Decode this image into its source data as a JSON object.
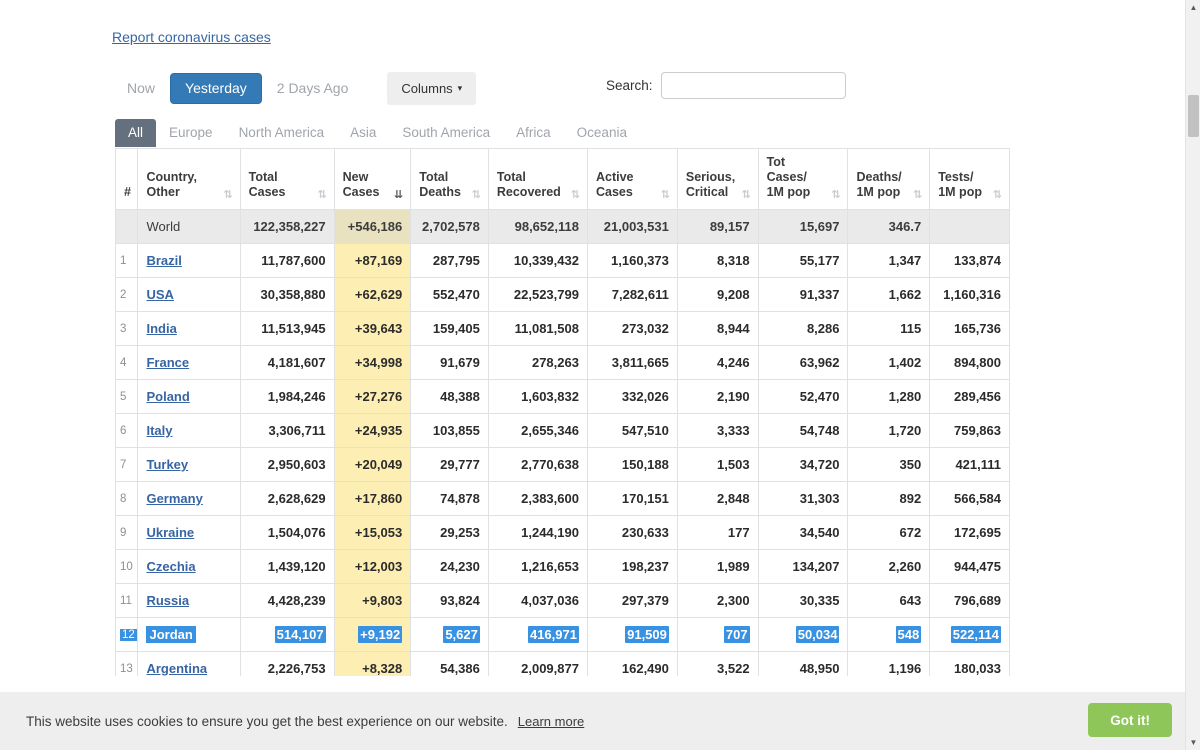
{
  "report_link": "Report coronavirus cases",
  "toolbar": {
    "days": [
      {
        "label": "Now",
        "active": false
      },
      {
        "label": "Yesterday",
        "active": true
      },
      {
        "label": "2 Days Ago",
        "active": false
      }
    ],
    "columns_label": "Columns",
    "columns_caret": "▾",
    "search_label": "Search:",
    "search_value": "",
    "search_placeholder": ""
  },
  "tabs": [
    {
      "label": "All",
      "active": true
    },
    {
      "label": "Europe",
      "active": false
    },
    {
      "label": "North America",
      "active": false
    },
    {
      "label": "Asia",
      "active": false
    },
    {
      "label": "South America",
      "active": false
    },
    {
      "label": "Africa",
      "active": false
    },
    {
      "label": "Oceania",
      "active": false
    }
  ],
  "table": {
    "headers": [
      {
        "key": "num",
        "line1": "#",
        "line2": "",
        "sort": "",
        "sort_active": false
      },
      {
        "key": "ctry",
        "line1": "Country,",
        "line2": "Other",
        "sort": "⇅",
        "sort_active": false
      },
      {
        "key": "tc",
        "line1": "Total",
        "line2": "Cases",
        "sort": "⇅",
        "sort_active": false
      },
      {
        "key": "nc",
        "line1": "New",
        "line2": "Cases",
        "sort": "⇊",
        "sort_active": true
      },
      {
        "key": "td",
        "line1": "Total",
        "line2": "Deaths",
        "sort": "⇅",
        "sort_active": false
      },
      {
        "key": "tr",
        "line1": "Total",
        "line2": "Recovered",
        "sort": "⇅",
        "sort_active": false
      },
      {
        "key": "ac",
        "line1": "Active",
        "line2": "Cases",
        "sort": "⇅",
        "sort_active": false
      },
      {
        "key": "sc",
        "line1": "Serious,",
        "line2": "Critical",
        "sort": "⇅",
        "sort_active": false
      },
      {
        "key": "tcm",
        "line1": "Tot Cases/",
        "line2": "1M pop",
        "sort": "⇅",
        "sort_active": false
      },
      {
        "key": "dm",
        "line1": "Deaths/",
        "line2": "1M pop",
        "sort": "⇅",
        "sort_active": false
      },
      {
        "key": "tm",
        "line1": "Tests/",
        "line2": "1M pop",
        "sort": "⇅",
        "sort_active": false
      }
    ],
    "world_row": {
      "num": "",
      "country": "World",
      "total_cases": "122,358,227",
      "new_cases": "+546,186",
      "total_deaths": "2,702,578",
      "total_recovered": "98,652,118",
      "active_cases": "21,003,531",
      "serious_critical": "89,157",
      "tot_cases_1m": "15,697",
      "deaths_1m": "346.7",
      "tests_1m": ""
    },
    "rows": [
      {
        "num": "1",
        "country": "Brazil",
        "total_cases": "11,787,600",
        "new_cases": "+87,169",
        "total_deaths": "287,795",
        "total_recovered": "10,339,432",
        "active_cases": "1,160,373",
        "serious_critical": "8,318",
        "tot_cases_1m": "55,177",
        "deaths_1m": "1,347",
        "tests_1m": "133,874",
        "selected": false
      },
      {
        "num": "2",
        "country": "USA",
        "total_cases": "30,358,880",
        "new_cases": "+62,629",
        "total_deaths": "552,470",
        "total_recovered": "22,523,799",
        "active_cases": "7,282,611",
        "serious_critical": "9,208",
        "tot_cases_1m": "91,337",
        "deaths_1m": "1,662",
        "tests_1m": "1,160,316",
        "selected": false
      },
      {
        "num": "3",
        "country": "India",
        "total_cases": "11,513,945",
        "new_cases": "+39,643",
        "total_deaths": "159,405",
        "total_recovered": "11,081,508",
        "active_cases": "273,032",
        "serious_critical": "8,944",
        "tot_cases_1m": "8,286",
        "deaths_1m": "115",
        "tests_1m": "165,736",
        "selected": false
      },
      {
        "num": "4",
        "country": "France",
        "total_cases": "4,181,607",
        "new_cases": "+34,998",
        "total_deaths": "91,679",
        "total_recovered": "278,263",
        "active_cases": "3,811,665",
        "serious_critical": "4,246",
        "tot_cases_1m": "63,962",
        "deaths_1m": "1,402",
        "tests_1m": "894,800",
        "selected": false
      },
      {
        "num": "5",
        "country": "Poland",
        "total_cases": "1,984,246",
        "new_cases": "+27,276",
        "total_deaths": "48,388",
        "total_recovered": "1,603,832",
        "active_cases": "332,026",
        "serious_critical": "2,190",
        "tot_cases_1m": "52,470",
        "deaths_1m": "1,280",
        "tests_1m": "289,456",
        "selected": false
      },
      {
        "num": "6",
        "country": "Italy",
        "total_cases": "3,306,711",
        "new_cases": "+24,935",
        "total_deaths": "103,855",
        "total_recovered": "2,655,346",
        "active_cases": "547,510",
        "serious_critical": "3,333",
        "tot_cases_1m": "54,748",
        "deaths_1m": "1,720",
        "tests_1m": "759,863",
        "selected": false
      },
      {
        "num": "7",
        "country": "Turkey",
        "total_cases": "2,950,603",
        "new_cases": "+20,049",
        "total_deaths": "29,777",
        "total_recovered": "2,770,638",
        "active_cases": "150,188",
        "serious_critical": "1,503",
        "tot_cases_1m": "34,720",
        "deaths_1m": "350",
        "tests_1m": "421,111",
        "selected": false
      },
      {
        "num": "8",
        "country": "Germany",
        "total_cases": "2,628,629",
        "new_cases": "+17,860",
        "total_deaths": "74,878",
        "total_recovered": "2,383,600",
        "active_cases": "170,151",
        "serious_critical": "2,848",
        "tot_cases_1m": "31,303",
        "deaths_1m": "892",
        "tests_1m": "566,584",
        "selected": false
      },
      {
        "num": "9",
        "country": "Ukraine",
        "total_cases": "1,504,076",
        "new_cases": "+15,053",
        "total_deaths": "29,253",
        "total_recovered": "1,244,190",
        "active_cases": "230,633",
        "serious_critical": "177",
        "tot_cases_1m": "34,540",
        "deaths_1m": "672",
        "tests_1m": "172,695",
        "selected": false
      },
      {
        "num": "10",
        "country": "Czechia",
        "total_cases": "1,439,120",
        "new_cases": "+12,003",
        "total_deaths": "24,230",
        "total_recovered": "1,216,653",
        "active_cases": "198,237",
        "serious_critical": "1,989",
        "tot_cases_1m": "134,207",
        "deaths_1m": "2,260",
        "tests_1m": "944,475",
        "selected": false
      },
      {
        "num": "11",
        "country": "Russia",
        "total_cases": "4,428,239",
        "new_cases": "+9,803",
        "total_deaths": "93,824",
        "total_recovered": "4,037,036",
        "active_cases": "297,379",
        "serious_critical": "2,300",
        "tot_cases_1m": "30,335",
        "deaths_1m": "643",
        "tests_1m": "796,689",
        "selected": false
      },
      {
        "num": "12",
        "country": "Jordan",
        "total_cases": "514,107",
        "new_cases": "+9,192",
        "total_deaths": "5,627",
        "total_recovered": "416,971",
        "active_cases": "91,509",
        "serious_critical": "707",
        "tot_cases_1m": "50,034",
        "deaths_1m": "548",
        "tests_1m": "522,114",
        "selected": true
      },
      {
        "num": "13",
        "country": "Argentina",
        "total_cases": "2,226,753",
        "new_cases": "+8,328",
        "total_deaths": "54,386",
        "total_recovered": "2,009,877",
        "active_cases": "162,490",
        "serious_critical": "3,522",
        "tot_cases_1m": "48,950",
        "deaths_1m": "1,196",
        "tests_1m": "180,033",
        "selected": false
      }
    ]
  },
  "cookie_banner": {
    "text": "This website uses cookies to ensure you get the best experience on our website.",
    "learn_more": "Learn more",
    "button": "Got it!"
  },
  "scrollbar": {
    "up_arrow": "▲",
    "down_arrow": "▼"
  },
  "colors": {
    "accent_blue": "#337ab7",
    "link_blue": "#3765a3",
    "selection_blue": "#3892e1",
    "new_cases_yellow": "#fdeeb4",
    "tab_active_gray": "#64707d",
    "cookie_green": "#8ec659"
  }
}
